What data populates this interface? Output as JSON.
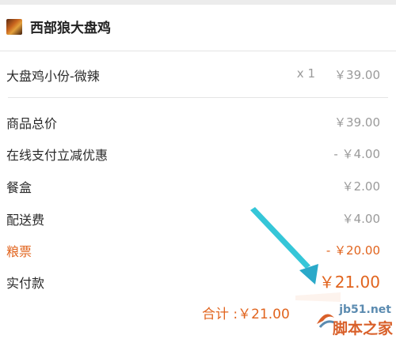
{
  "shop": {
    "name": "西部狼大盘鸡",
    "thumb_icon": "shop-thumbnail"
  },
  "item": {
    "name": "大盘鸡小份-微辣",
    "qty": "x 1",
    "price": "￥39.00"
  },
  "fees": [
    {
      "label": "商品总价",
      "value": "￥39.00"
    },
    {
      "label": "在线支付立减优惠",
      "value": "- ￥4.00"
    },
    {
      "label": "餐盒",
      "value": "￥2.00"
    },
    {
      "label": "配送费",
      "value": "￥4.00"
    },
    {
      "label": "粮票",
      "value": "- ￥20.00"
    }
  ],
  "paid": {
    "label": "实付款",
    "value": "￥21.00"
  },
  "total": {
    "text": "合计 :￥21.00"
  },
  "annotation": {
    "arrow_color": "#35c6d8",
    "accent": "#e1641e"
  },
  "watermark": {
    "site": "jb51.net",
    "brand": "脚本之家"
  }
}
